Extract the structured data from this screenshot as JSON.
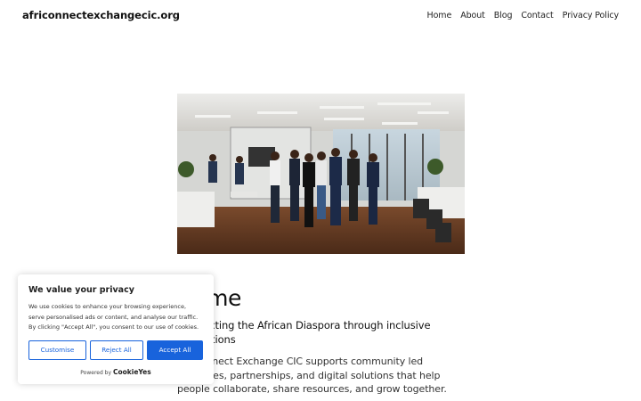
{
  "header": {
    "site_title": "africonnectexchangecic.org",
    "nav": [
      "Home",
      "About",
      "Blog",
      "Contact",
      "Privacy Policy"
    ]
  },
  "main": {
    "heading": "Home",
    "tagline": "Connecting the African Diaspora through inclusive innovations",
    "intro": "AfriConnect Exchange CIC supports community led initiatives, partnerships, and digital solutions that help people collaborate, share resources, and grow together."
  },
  "cookie_banner": {
    "title": "We value your privacy",
    "text": "We use cookies to enhance your browsing experience, serve personalised ads or content, and analyse our traffic. By clicking \"Accept All\", you consent to our use of cookies.",
    "customise_label": "Customise",
    "reject_label": "Reject All",
    "accept_label": "Accept All",
    "powered_by": "Powered by",
    "brand": "CookieYes",
    "accent_color": "#1863dc"
  }
}
